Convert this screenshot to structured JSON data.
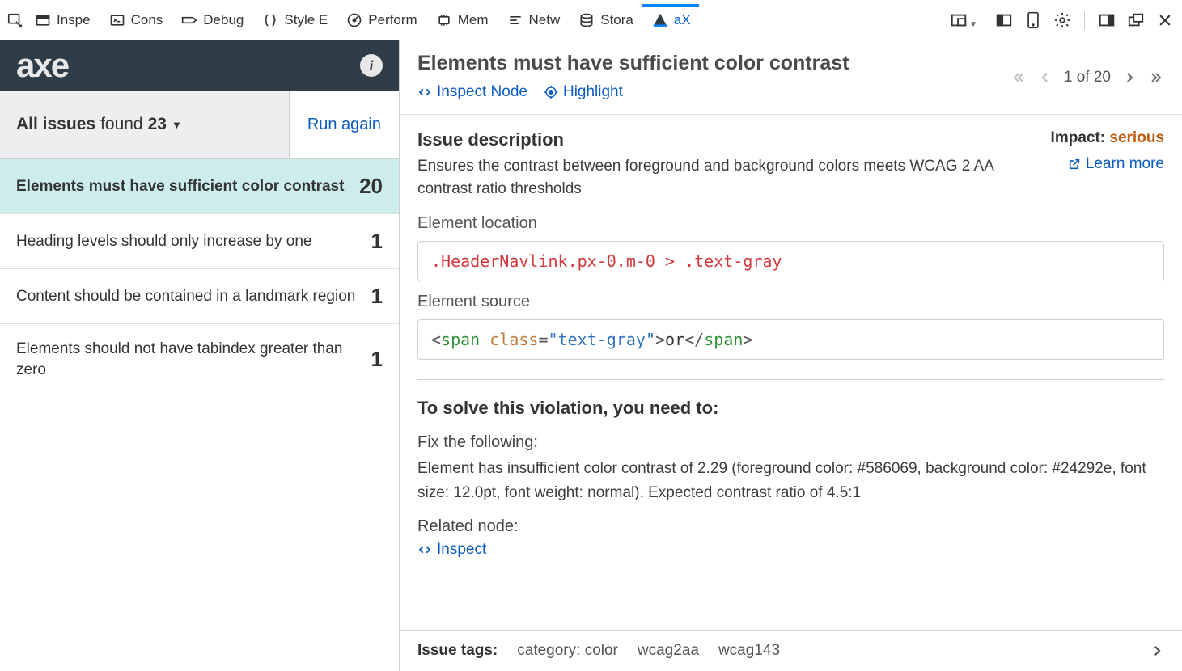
{
  "toolbar": {
    "tabs": [
      {
        "id": "inspector",
        "label": "Inspe"
      },
      {
        "id": "console",
        "label": "Cons"
      },
      {
        "id": "debugger",
        "label": "Debug"
      },
      {
        "id": "styleeditor",
        "label": "Style E"
      },
      {
        "id": "performance",
        "label": "Perform"
      },
      {
        "id": "memory",
        "label": "Mem"
      },
      {
        "id": "network",
        "label": "Netw"
      },
      {
        "id": "storage",
        "label": "Stora"
      },
      {
        "id": "axe",
        "label": "aX"
      }
    ]
  },
  "sidebar": {
    "filter_label_bold": "All issues",
    "filter_label_rest": "found",
    "filter_count": "23",
    "run_again": "Run again",
    "issues": [
      {
        "label": "Elements must have sufficient color contrast",
        "count": "20",
        "selected": true
      },
      {
        "label": "Heading levels should only increase by one",
        "count": "1"
      },
      {
        "label": "Content should be contained in a landmark region",
        "count": "1"
      },
      {
        "label": "Elements should not have tabindex greater than zero",
        "count": "1"
      }
    ]
  },
  "detail": {
    "title": "Elements must have sufficient color contrast",
    "inspect_node": "Inspect Node",
    "highlight": "Highlight",
    "pager_pos": "1 of 20",
    "description_h": "Issue description",
    "description": "Ensures the contrast between foreground and background colors meets WCAG 2 AA contrast ratio thresholds",
    "impact_label": "Impact:",
    "impact_value": "serious",
    "learn_more": "Learn more",
    "location_h": "Element location",
    "location": ".HeaderNavlink.px-0.m-0 > .text-gray",
    "source_h": "Element source",
    "source": {
      "open_tag": "span",
      "attr_name": "class",
      "attr_val": "text-gray",
      "text": "or",
      "close_tag": "span"
    },
    "solve_h": "To solve this violation, you need to:",
    "fix_h": "Fix the following:",
    "fix_text": "Element has insufficient color contrast of 2.29 (foreground color: #586069, background color: #24292e, font size: 12.0pt, font weight: normal). Expected contrast ratio of 4.5:1",
    "related_h": "Related node:",
    "inspect_link": "Inspect",
    "tags_label": "Issue tags:",
    "tags": [
      "category: color",
      "wcag2aa",
      "wcag143"
    ]
  }
}
